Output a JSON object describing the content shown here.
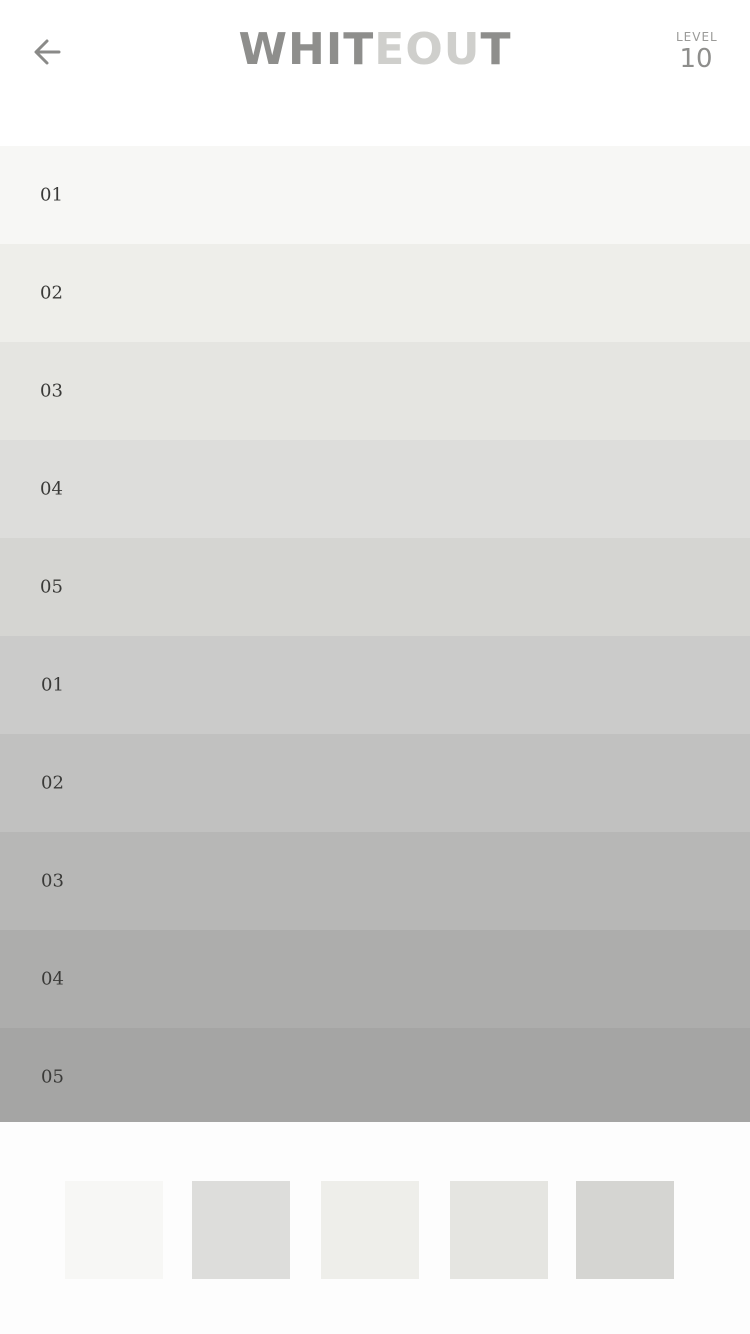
{
  "header": {
    "title_dark": "WHIT",
    "title_light": "EOU",
    "title_dark_end": "T",
    "level_label": "LEVEL",
    "level_value": "10"
  },
  "icons": {
    "back": "arrow-left-icon"
  },
  "rows": [
    {
      "label": "01",
      "color": "#f7f7f5"
    },
    {
      "label": "02",
      "color": "#eeeeea"
    },
    {
      "label": "03",
      "color": "#e5e5e1"
    },
    {
      "label": "04",
      "color": "#dddddb"
    },
    {
      "label": "05",
      "color": "#d5d5d2"
    },
    {
      "label": "01",
      "color": "#cbcbca"
    },
    {
      "label": "02",
      "color": "#c1c1c0"
    },
    {
      "label": "03",
      "color": "#b7b7b6"
    },
    {
      "label": "04",
      "color": "#adadac"
    },
    {
      "label": "05",
      "color": "#a5a5a4"
    }
  ],
  "swatches": [
    {
      "color": "#f7f7f5"
    },
    {
      "color": "#dddddb"
    },
    {
      "color": "#eeeeea"
    },
    {
      "color": "#e5e5e1"
    },
    {
      "color": "#d5d5d2"
    }
  ],
  "colors": {
    "title": "#8e8e8c",
    "title_faded": "#cfcfcc",
    "tray_background": "#fdfdfd"
  }
}
